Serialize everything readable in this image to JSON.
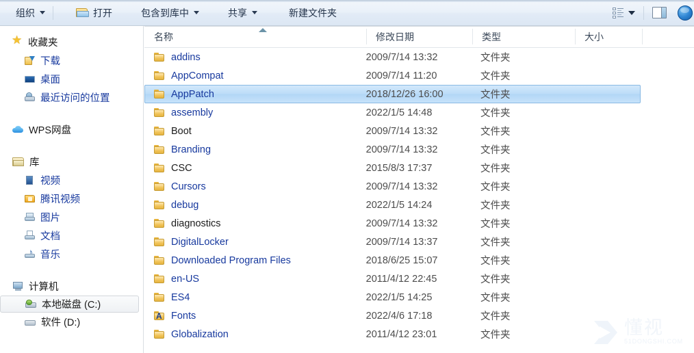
{
  "toolbar": {
    "organize_label": "组织",
    "open_label": "打开",
    "include_in_library_label": "包含到库中",
    "share_label": "共享",
    "new_folder_label": "新建文件夹",
    "view_label": "",
    "preview_pane_label": "",
    "help_label": ""
  },
  "sidebar": {
    "groups": [
      {
        "label": "收藏夹",
        "icon": "star-icon",
        "items": [
          {
            "label": "下载",
            "icon": "download-icon"
          },
          {
            "label": "桌面",
            "icon": "desktop-icon"
          },
          {
            "label": "最近访问的位置",
            "icon": "recent-places-icon"
          }
        ]
      },
      {
        "label": "WPS网盘",
        "icon": "cloud-icon",
        "items": []
      },
      {
        "label": "库",
        "icon": "library-icon",
        "items": [
          {
            "label": "视频",
            "icon": "video-icon"
          },
          {
            "label": "腾讯视频",
            "icon": "tencent-video-icon"
          },
          {
            "label": "图片",
            "icon": "pictures-icon"
          },
          {
            "label": "文档",
            "icon": "documents-icon"
          },
          {
            "label": "音乐",
            "icon": "music-icon"
          }
        ]
      },
      {
        "label": "计算机",
        "icon": "computer-icon",
        "items": [
          {
            "label": "本地磁盘 (C:)",
            "icon": "drive-c-icon",
            "selected": true
          },
          {
            "label": "软件 (D:)",
            "icon": "drive-d-icon"
          }
        ]
      }
    ]
  },
  "filelist": {
    "columns": {
      "name": "名称",
      "date_modified": "修改日期",
      "type": "类型",
      "size": "大小"
    },
    "sort_column": "名称",
    "sort_direction": "ascending",
    "rows": [
      {
        "name": "addins",
        "date": "2009/7/14 13:32",
        "type": "文件夹",
        "size": "",
        "icon": "folder-icon",
        "name_color": "blue"
      },
      {
        "name": "AppCompat",
        "date": "2009/7/14 11:20",
        "type": "文件夹",
        "size": "",
        "icon": "folder-icon",
        "name_color": "blue"
      },
      {
        "name": "AppPatch",
        "date": "2018/12/26 16:00",
        "type": "文件夹",
        "size": "",
        "icon": "folder-icon",
        "name_color": "blue",
        "selected": true
      },
      {
        "name": "assembly",
        "date": "2022/1/5 14:48",
        "type": "文件夹",
        "size": "",
        "icon": "folder-icon",
        "name_color": "blue"
      },
      {
        "name": "Boot",
        "date": "2009/7/14 13:32",
        "type": "文件夹",
        "size": "",
        "icon": "folder-icon",
        "name_color": "black"
      },
      {
        "name": "Branding",
        "date": "2009/7/14 13:32",
        "type": "文件夹",
        "size": "",
        "icon": "folder-icon",
        "name_color": "blue"
      },
      {
        "name": "CSC",
        "date": "2015/8/3 17:37",
        "type": "文件夹",
        "size": "",
        "icon": "folder-icon",
        "name_color": "black"
      },
      {
        "name": "Cursors",
        "date": "2009/7/14 13:32",
        "type": "文件夹",
        "size": "",
        "icon": "folder-icon",
        "name_color": "blue"
      },
      {
        "name": "debug",
        "date": "2022/1/5 14:24",
        "type": "文件夹",
        "size": "",
        "icon": "folder-icon",
        "name_color": "blue"
      },
      {
        "name": "diagnostics",
        "date": "2009/7/14 13:32",
        "type": "文件夹",
        "size": "",
        "icon": "folder-icon",
        "name_color": "black"
      },
      {
        "name": "DigitalLocker",
        "date": "2009/7/14 13:37",
        "type": "文件夹",
        "size": "",
        "icon": "folder-icon",
        "name_color": "blue"
      },
      {
        "name": "Downloaded Program Files",
        "date": "2018/6/25 15:07",
        "type": "文件夹",
        "size": "",
        "icon": "folder-icon",
        "name_color": "blue"
      },
      {
        "name": "en-US",
        "date": "2011/4/12 22:45",
        "type": "文件夹",
        "size": "",
        "icon": "folder-icon",
        "name_color": "blue"
      },
      {
        "name": "ES4",
        "date": "2022/1/5 14:25",
        "type": "文件夹",
        "size": "",
        "icon": "folder-icon",
        "name_color": "blue"
      },
      {
        "name": "Fonts",
        "date": "2022/4/6 17:18",
        "type": "文件夹",
        "size": "",
        "icon": "fonts-folder-icon",
        "name_color": "blue"
      },
      {
        "name": "Globalization",
        "date": "2011/4/12 23:01",
        "type": "文件夹",
        "size": "",
        "icon": "folder-icon",
        "name_color": "blue"
      }
    ]
  },
  "watermark": {
    "cn": "懂视",
    "en": "51DONGSHI.COM"
  },
  "colors": {
    "link_blue": "#17399e",
    "selection_blue": "#bcdcf8",
    "folder_gold": "#f0c257",
    "toolbar_bg": "#e6eef8"
  }
}
